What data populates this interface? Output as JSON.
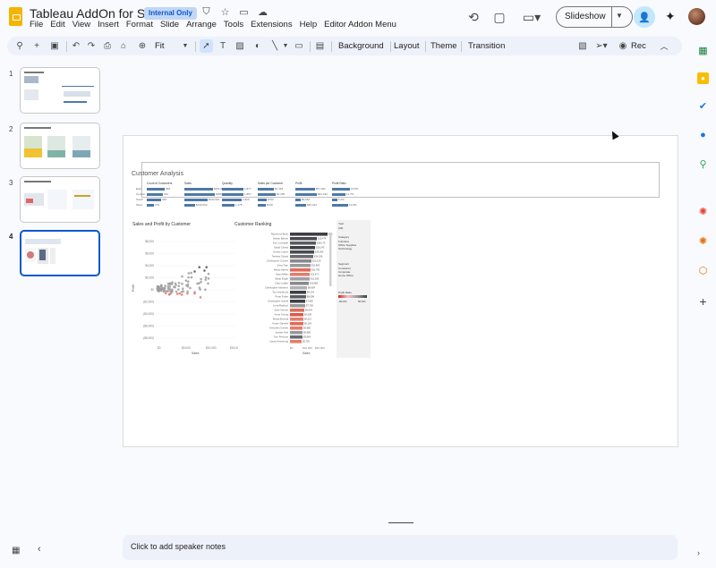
{
  "app": {
    "title": "Tableau AddOn for Slides",
    "badge": "Internal Only",
    "menu": [
      "File",
      "Edit",
      "View",
      "Insert",
      "Format",
      "Slide",
      "Arrange",
      "Tools",
      "Extensions",
      "Help",
      "Editor Addon Menu"
    ],
    "slideshow_label": "Slideshow"
  },
  "toolbar": {
    "zoom": "Fit",
    "background": "Background",
    "layout": "Layout",
    "theme": "Theme",
    "transition": "Transition",
    "rec": "Rec"
  },
  "filmstrip": {
    "numbers": [
      "1",
      "2",
      "3",
      "4"
    ],
    "active_index": 4
  },
  "slide": {
    "dashboard_title": "Customer Analysis",
    "kpi_headers": [
      "Count of Customers",
      "Sales",
      "Quantity",
      "Sales per Customer",
      "Profit",
      "Profit Ratio"
    ],
    "kpi_values": [
      [
        "358",
        "$261,660",
        "1,877",
        "$1,318",
        "$57,401",
        "15.8%"
      ],
      [
        "344",
        "$286,480",
        "1,897",
        "$1,390",
        "$61,192",
        "11.7%"
      ],
      [
        "329",
        "$232,501",
        "1,826",
        "$760",
        "$9,564",
        "5.4%"
      ],
      [
        "279",
        "$130,093",
        "1,178",
        "$709",
        "$26,014",
        "13.8%"
      ]
    ],
    "kpi_row_labels": [
      "East",
      "Central",
      "South",
      "West"
    ],
    "scatter_title": "Sales and Profit by Customer",
    "ranking_title": "Customer Ranking",
    "ranking_customers": [
      "Raymond Buch",
      "Adrian Barton",
      "Ken Lonsdale",
      "Sanjit Chand",
      "Hunter Lopez",
      "Tamara Chand",
      "Christopher Conant",
      "Greg Tran",
      "Becky Martin",
      "Sean Miller",
      "Sanjit Engle",
      "Clay Ludtke",
      "Christopher Martinez",
      "Tom Ashbrook",
      "Peter Fuller",
      "Christopher Schild",
      "Lena Radford",
      "Seth Vernon",
      "Anna Chung",
      "Maria Etezadi",
      "Karen Daniels",
      "Gretchen Garrett",
      "Joseph Holt",
      "Tom Prescott",
      "Laura Armstrong"
    ],
    "ranking_values": [
      "$65,127",
      "$19,474",
      "$18,175",
      "$16,243",
      "$16,000",
      "$14,256",
      "$12,129",
      "$11,842",
      "$11,790",
      "$11,471",
      "$11,265",
      "$10,881",
      "$8,954",
      "$8,134",
      "$8,098",
      "$7,860",
      "$7,700",
      "$6,644",
      "$6,508",
      "$6,212",
      "$6,104",
      "$5,980",
      "$5,880",
      "$5,864",
      "$5,750"
    ],
    "scatter_y_ticks": [
      "$8,000",
      "$6,000",
      "$4,000",
      "$2,000",
      "$0",
      "($2,000)",
      "($4,000)",
      "($6,000)",
      "($8,000)"
    ],
    "scatter_x_ticks": [
      "$0",
      "$5,000",
      "$10,000",
      "$15,000"
    ],
    "ranking_x_ticks": [
      "$0",
      "$10,000",
      "$20,000"
    ],
    "scatter_x_label": "Sales",
    "ranking_x_label": "Sales",
    "scatter_y_label": "Profit",
    "filter_year_label": "Year",
    "filter_year_value": "(All)",
    "filter_category_label": "Category",
    "filter_categories": [
      "Furniture",
      "Office Supplies",
      "Technology"
    ],
    "filter_segment_label": "Segment",
    "filter_segments": [
      "Consumer",
      "Corporate",
      "Home Office"
    ],
    "profit_ratio_label": "Profit Ratio",
    "profit_ratio_range": [
      "-50.0%",
      "50.0%"
    ]
  },
  "notes": {
    "placeholder": "Click to add speaker notes"
  },
  "colors": {
    "accent": "#0b57d0",
    "bar_blue": "#4e79a7",
    "bar_red": "#e15759",
    "bar_dark": "#3f3f46"
  }
}
